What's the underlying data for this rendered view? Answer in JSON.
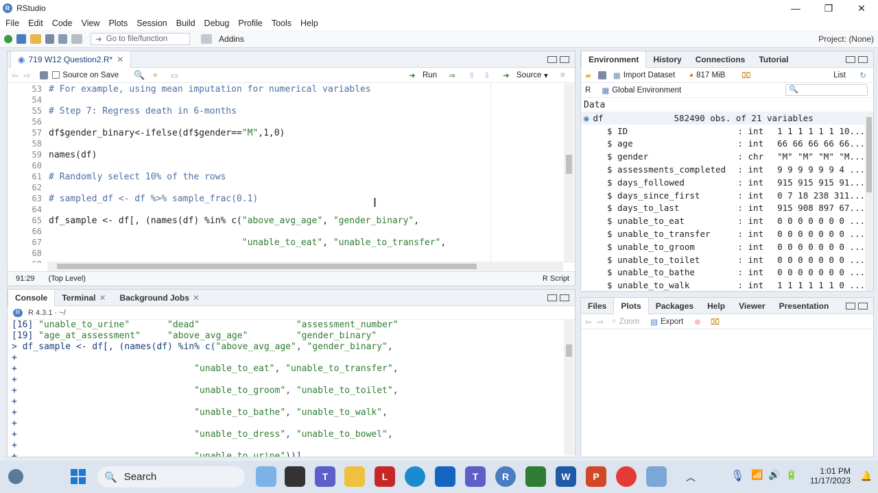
{
  "window": {
    "title": "RStudio",
    "minimize": "—",
    "maximize": "❐",
    "close": "✕"
  },
  "menu": [
    "File",
    "Edit",
    "Code",
    "View",
    "Plots",
    "Session",
    "Build",
    "Debug",
    "Profile",
    "Tools",
    "Help"
  ],
  "toolbar": {
    "goto_placeholder": "Go to file/function",
    "addins": "Addins",
    "project": "Project: (None)"
  },
  "editor": {
    "tab": "719 W12 Question2.R*",
    "source_on_save": "Source on Save",
    "run": "Run",
    "source": "Source",
    "status_pos": "91:29",
    "status_scope": "(Top Level)",
    "status_type": "R Script",
    "lines": [
      {
        "n": "53",
        "t": "# For example, using mean imputation for numerical variables",
        "k": "comment"
      },
      {
        "n": "54",
        "t": "",
        "k": "code"
      },
      {
        "n": "55",
        "t": "# Step 7: Regress death in 6-months",
        "k": "comment"
      },
      {
        "n": "56",
        "t": "",
        "k": "code"
      },
      {
        "n": "57",
        "t": "df$gender_binary<-ifelse(df$gender==\"M\",1,0)",
        "k": "code"
      },
      {
        "n": "58",
        "t": "",
        "k": "code"
      },
      {
        "n": "59",
        "t": "names(df)",
        "k": "code"
      },
      {
        "n": "60",
        "t": "",
        "k": "code"
      },
      {
        "n": "61",
        "t": "# Randomly select 10% of the rows",
        "k": "comment"
      },
      {
        "n": "62",
        "t": "",
        "k": "code"
      },
      {
        "n": "63",
        "t": "# sampled_df <- df %>% sample_frac(0.1)",
        "k": "comment"
      },
      {
        "n": "64",
        "t": "",
        "k": "code"
      },
      {
        "n": "65",
        "t": "df_sample <- df[, (names(df) %in% c(\"above_avg_age\", \"gender_binary\",",
        "k": "code"
      },
      {
        "n": "66",
        "t": "",
        "k": "code"
      },
      {
        "n": "67",
        "t": "                                    \"unable_to_eat\", \"unable_to_transfer\",",
        "k": "code"
      },
      {
        "n": "68",
        "t": "",
        "k": "code"
      },
      {
        "n": "69",
        "t": "",
        "k": "code"
      }
    ]
  },
  "console": {
    "tabs": [
      "Console",
      "Terminal",
      "Background Jobs"
    ],
    "version": "R 4.3.1 · ~/",
    "lines": [
      "[16] \"unable_to_urine\"       \"dead\"                  \"assessment_number\"",
      "[19] \"age_at_assessment\"     \"above_avg_age\"         \"gender_binary\"",
      "> df_sample <- df[, (names(df) %in% c(\"above_avg_age\", \"gender_binary\",",
      "+",
      "+                                 \"unable_to_eat\", \"unable_to_transfer\",",
      "+",
      "+                                 \"unable_to_groom\", \"unable_to_toilet\",",
      "+",
      "+                                 \"unable_to_bathe\", \"unable_to_walk\",",
      "+",
      "+                                 \"unable_to_dress\", \"unable_to_bowel\",",
      "+",
      "+                                 \"unable_to_urine\"))]"
    ]
  },
  "env": {
    "tabs": [
      "Environment",
      "History",
      "Connections",
      "Tutorial"
    ],
    "import": "Import Dataset",
    "memory": "817 MiB",
    "list": "List",
    "lang": "R",
    "scope": "Global Environment",
    "section": "Data",
    "df_name": "df",
    "df_desc": "582490 obs. of 21 variables",
    "vars": [
      {
        "name": "$ ID",
        "type": ": int",
        "val": "1 1 1 1 1 1 10..."
      },
      {
        "name": "$ age",
        "type": ": int",
        "val": "66 66 66 66 66..."
      },
      {
        "name": "$ gender",
        "type": ": chr",
        "val": "\"M\" \"M\" \"M\" \"M..."
      },
      {
        "name": "$ assessments_completed",
        "type": ": int",
        "val": "9 9 9 9 9 9 4 ..."
      },
      {
        "name": "$ days_followed",
        "type": ": int",
        "val": "915 915 915 91..."
      },
      {
        "name": "$ days_since_first",
        "type": ": int",
        "val": "0 7 18 238 311..."
      },
      {
        "name": "$ days_to_last",
        "type": ": int",
        "val": "915 908 897 67..."
      },
      {
        "name": "$ unable_to_eat",
        "type": ": int",
        "val": "0 0 0 0 0 0 0 ..."
      },
      {
        "name": "$ unable_to_transfer",
        "type": ": int",
        "val": "0 0 0 0 0 0 0 ..."
      },
      {
        "name": "$ unable_to_groom",
        "type": ": int",
        "val": "0 0 0 0 0 0 0 ..."
      },
      {
        "name": "$ unable_to_toilet",
        "type": ": int",
        "val": "0 0 0 0 0 0 0 ..."
      },
      {
        "name": "$ unable_to_bathe",
        "type": ": int",
        "val": "0 0 0 0 0 0 0 ..."
      },
      {
        "name": "$ unable_to_walk",
        "type": ": int",
        "val": "1 1 1 1 1 1 0 ..."
      }
    ]
  },
  "files": {
    "tabs": [
      "Files",
      "Plots",
      "Packages",
      "Help",
      "Viewer",
      "Presentation"
    ],
    "zoom": "Zoom",
    "export": "Export"
  },
  "taskbar": {
    "search": "Search",
    "time": "1:01 PM",
    "date": "11/17/2023"
  }
}
